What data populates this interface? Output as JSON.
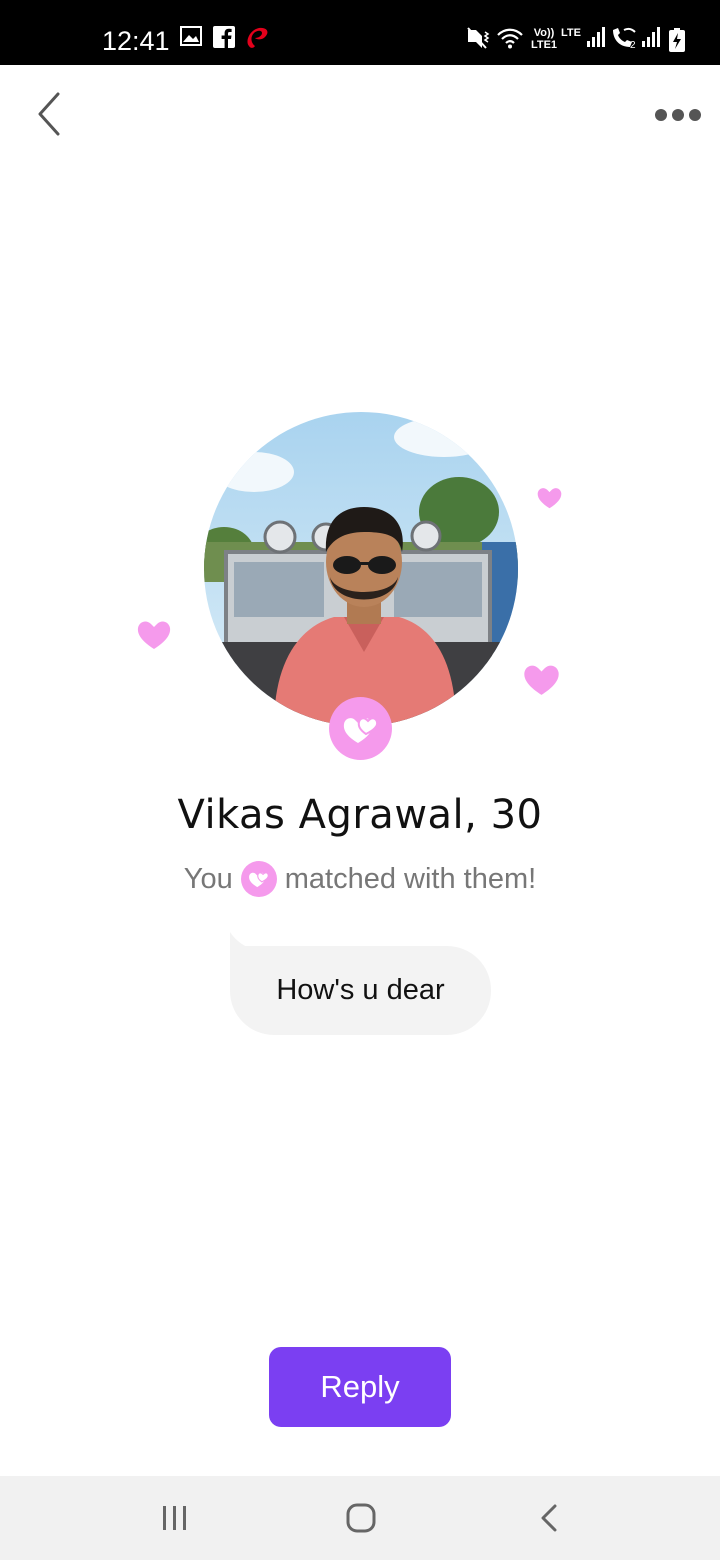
{
  "status_bar": {
    "time": "12:41",
    "left_icons": [
      "gallery-icon",
      "facebook-icon",
      "airtel-icon"
    ],
    "right_icons": [
      "mute-vibrate-icon",
      "wifi-icon",
      "signal-icon",
      "wifi-calling-icon",
      "signal-icon-2",
      "battery-charging-icon"
    ],
    "network_text_1": "Vo)) LTE1",
    "network_text_2": "LTE"
  },
  "top_bar": {
    "back_icon": "chevron-left-icon",
    "more_icon": "more-horizontal-icon"
  },
  "profile": {
    "name": "Vikas Agrawal, 30",
    "photo_icon": "profile-photo",
    "badge_icon": "match-hearts-icon"
  },
  "match": {
    "prefix": "You",
    "suffix": "matched with them!"
  },
  "message": {
    "text": "How's u dear"
  },
  "reply_button": {
    "label": "Reply"
  },
  "nav_bar": {
    "recents_icon": "recents-icon",
    "home_icon": "home-icon",
    "back_icon": "back-icon"
  },
  "colors": {
    "accent": "#7b3ff2",
    "heart_pink": "#f59aec",
    "bubble": "#f3f3f3",
    "subtext": "#777777"
  }
}
